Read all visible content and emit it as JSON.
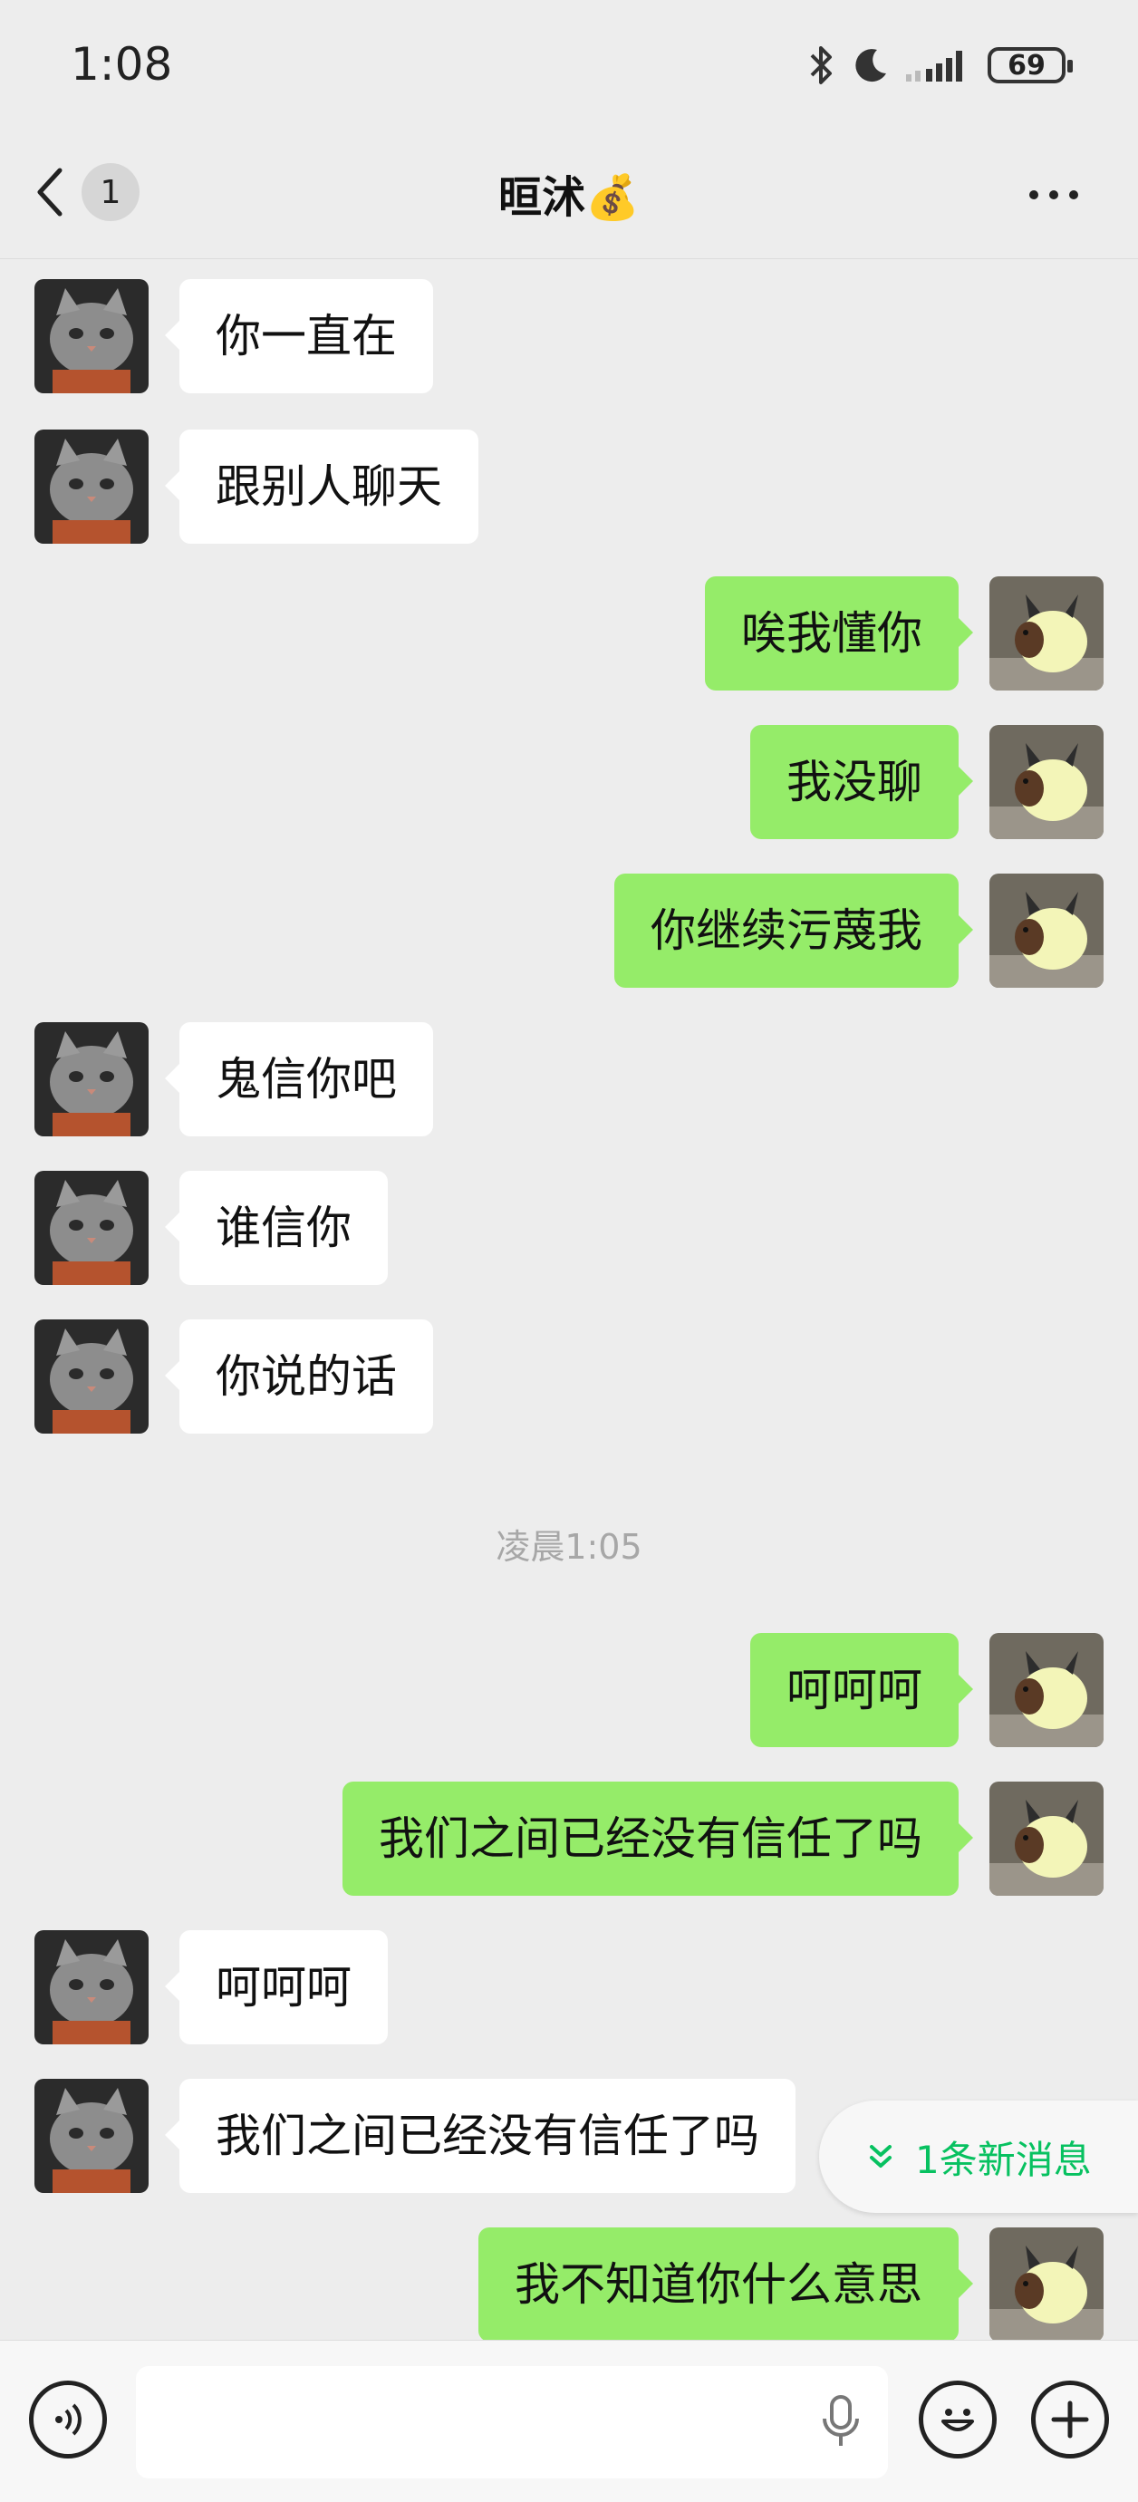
{
  "status_bar": {
    "time": "1:08",
    "battery": "69"
  },
  "nav": {
    "back_badge": "1",
    "title": "晅沭💰"
  },
  "messages": [
    {
      "side": "left",
      "text": "你一直在"
    },
    {
      "side": "left",
      "text": "跟别人聊天"
    },
    {
      "side": "right",
      "text": "唉我懂你"
    },
    {
      "side": "right",
      "text": "我没聊"
    },
    {
      "side": "right",
      "text": "你继续污蔑我"
    },
    {
      "side": "left",
      "text": "鬼信你吧"
    },
    {
      "side": "left",
      "text": "谁信你"
    },
    {
      "side": "left",
      "text": "你说的话"
    },
    {
      "side": "right",
      "text": "呵呵呵"
    },
    {
      "side": "right",
      "text": "我们之间已经没有信任了吗"
    },
    {
      "side": "left",
      "text": "呵呵呵"
    },
    {
      "side": "left",
      "text": "我们之间已经没有信任了吗"
    },
    {
      "side": "right",
      "text": "我不知道你什么意思"
    }
  ],
  "timestamp": "凌晨1:05",
  "new_messages_label": "1条新消息",
  "icons": {
    "status": [
      "bluetooth-icon",
      "moon-icon",
      "signal-icon",
      "battery-icon"
    ],
    "nav": [
      "back-arrow-icon",
      "more-icon"
    ],
    "input": [
      "voice-icon",
      "mic-icon",
      "emoji-icon",
      "plus-icon"
    ]
  },
  "colors": {
    "background": "#ededed",
    "outgoing_bubble": "#95ec69",
    "incoming_bubble": "#ffffff",
    "accent": "#07c160"
  }
}
